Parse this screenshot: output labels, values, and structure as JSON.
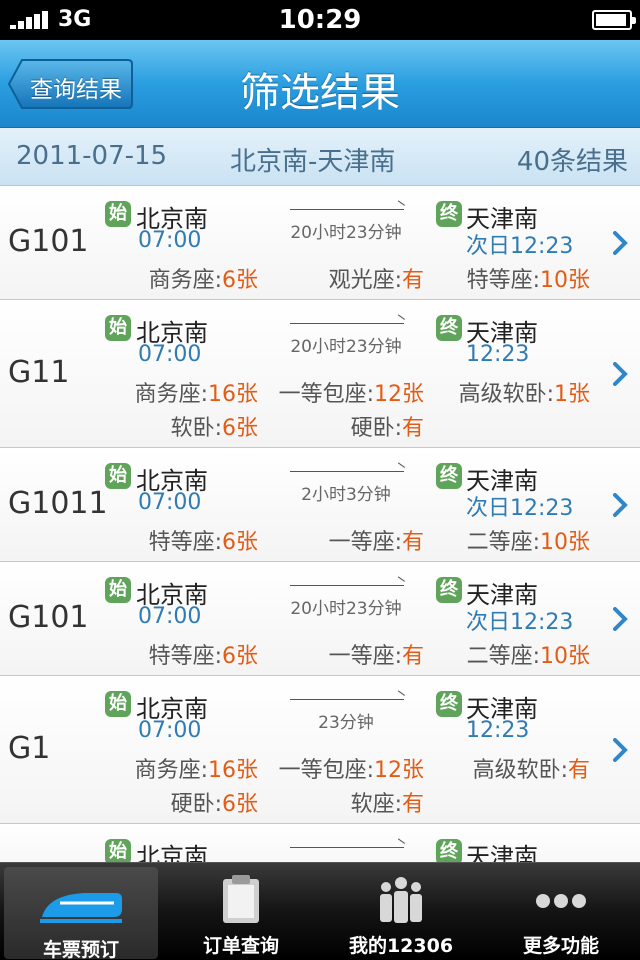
{
  "status_bar": {
    "network": "3G",
    "time": "10:29"
  },
  "nav": {
    "back_label": "查询结果",
    "title": "筛选结果"
  },
  "summary": {
    "date": "2011-07-15",
    "route": "北京南-天津南",
    "count": "40条结果"
  },
  "labels": {
    "start_badge": "始",
    "end_badge": "终"
  },
  "trains": [
    {
      "number": "G101",
      "from": "北京南",
      "depart": "07:00",
      "duration": "20小时23分钟",
      "to": "天津南",
      "arrive": "次日12:23",
      "seats": [
        [
          "商务座:",
          "6张"
        ],
        [
          "观光座:",
          "有"
        ],
        [
          "特等座:",
          "10张"
        ]
      ]
    },
    {
      "number": "G11",
      "from": "北京南",
      "depart": "07:00",
      "duration": "20小时23分钟",
      "to": "天津南",
      "arrive": "12:23",
      "seats": [
        [
          "商务座:",
          "16张"
        ],
        [
          "一等包座:",
          "12张"
        ],
        [
          "高级软卧:",
          "1张"
        ],
        [
          "软卧:",
          "6张"
        ],
        [
          "硬卧:",
          "有"
        ]
      ]
    },
    {
      "number": "G1011",
      "from": "北京南",
      "depart": "07:00",
      "duration": "2小时3分钟",
      "to": "天津南",
      "arrive": "次日12:23",
      "seats": [
        [
          "特等座:",
          "6张"
        ],
        [
          "一等座:",
          "有"
        ],
        [
          "二等座:",
          "10张"
        ]
      ]
    },
    {
      "number": "G101",
      "from": "北京南",
      "depart": "07:00",
      "duration": "20小时23分钟",
      "to": "天津南",
      "arrive": "次日12:23",
      "seats": [
        [
          "特等座:",
          "6张"
        ],
        [
          "一等座:",
          "有"
        ],
        [
          "二等座:",
          "10张"
        ]
      ]
    },
    {
      "number": "G1",
      "from": "北京南",
      "depart": "07:00",
      "duration": "23分钟",
      "to": "天津南",
      "arrive": "12:23",
      "seats": [
        [
          "商务座:",
          "16张"
        ],
        [
          "一等包座:",
          "12张"
        ],
        [
          "高级软卧:",
          "有"
        ],
        [
          "硬卧:",
          "6张"
        ],
        [
          "软座:",
          "有"
        ]
      ]
    },
    {
      "number": "",
      "from": "北京南",
      "depart": "",
      "duration": "",
      "to": "天津南",
      "arrive": "",
      "seats": []
    }
  ],
  "tabs": [
    {
      "label": "车票预订",
      "icon": "train-icon",
      "active": true
    },
    {
      "label": "订单查询",
      "icon": "clipboard-icon",
      "active": false
    },
    {
      "label": "我的12306",
      "icon": "people-icon",
      "active": false
    },
    {
      "label": "更多功能",
      "icon": "more-dots-icon",
      "active": false
    }
  ],
  "colors": {
    "nav_blue": "#2a9ee0",
    "time_blue": "#2f7bb4",
    "count_orange": "#e25c16",
    "badge_green": "#5fa45a"
  }
}
